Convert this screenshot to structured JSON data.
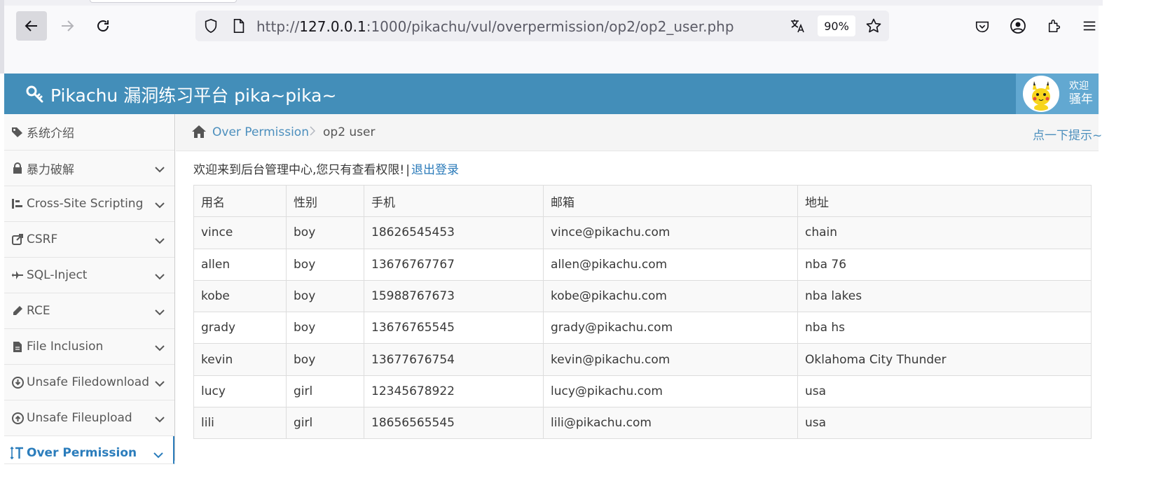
{
  "browser": {
    "url_prefix": "http://",
    "url_host": "127.0.0.1",
    "url_rest": ":1000/pikachu/vul/overpermission/op2/op2_user.php",
    "zoom": "90%"
  },
  "app": {
    "title": "Pikachu 漏洞练习平台 pika~pika~",
    "welcome_line1": "欢迎",
    "welcome_line2": "骚年"
  },
  "sidebar": {
    "items": [
      {
        "label": "系统介绍",
        "icon": "tags-icon"
      },
      {
        "label": "暴力破解",
        "icon": "lock-icon"
      },
      {
        "label": "Cross-Site Scripting",
        "icon": "sitemap-icon"
      },
      {
        "label": "CSRF",
        "icon": "share-icon"
      },
      {
        "label": "SQL-Inject",
        "icon": "plane-icon"
      },
      {
        "label": "RCE",
        "icon": "pencil-icon"
      },
      {
        "label": "File Inclusion",
        "icon": "file-icon"
      },
      {
        "label": "Unsafe Filedownload",
        "icon": "download-icon"
      },
      {
        "label": "Unsafe Fileupload",
        "icon": "upload-icon"
      },
      {
        "label": "Over Permission",
        "icon": "text-height-icon"
      }
    ]
  },
  "breadcrumb": {
    "parent": "Over Permission",
    "current": "op2 user",
    "hint": "点一下提示~"
  },
  "main": {
    "notice": "欢迎来到后台管理中心,您只有查看权限!",
    "separator": "|",
    "logout": "退出登录",
    "columns": [
      "用名",
      "性别",
      "手机",
      "邮箱",
      "地址"
    ],
    "rows": [
      [
        "vince",
        "boy",
        "18626545453",
        "vince@pikachu.com",
        "chain"
      ],
      [
        "allen",
        "boy",
        "13676767767",
        "allen@pikachu.com",
        "nba 76"
      ],
      [
        "kobe",
        "boy",
        "15988767673",
        "kobe@pikachu.com",
        "nba lakes"
      ],
      [
        "grady",
        "boy",
        "13676765545",
        "grady@pikachu.com",
        "nba hs"
      ],
      [
        "kevin",
        "boy",
        "13677676754",
        "kevin@pikachu.com",
        "Oklahoma City Thunder"
      ],
      [
        "lucy",
        "girl",
        "12345678922",
        "lucy@pikachu.com",
        "usa"
      ],
      [
        "lili",
        "girl",
        "18656565545",
        "lili@pikachu.com",
        "usa"
      ]
    ]
  }
}
